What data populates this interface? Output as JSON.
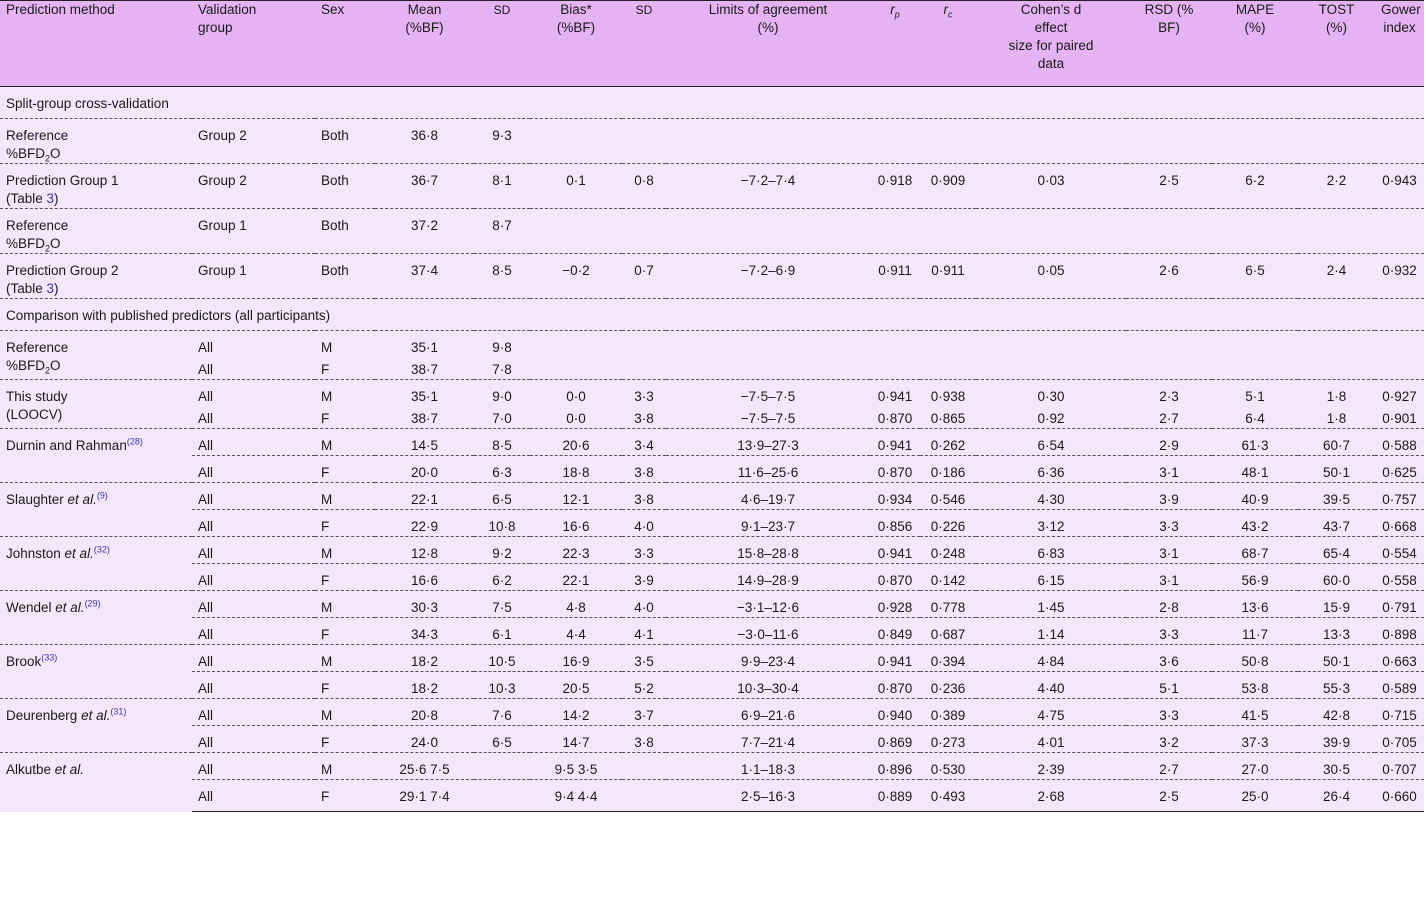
{
  "header": {
    "method": "Prediction method",
    "group": "Validation group",
    "sex": "Sex",
    "mean": "Mean (%BF)",
    "sd1": "SD",
    "bias": "Bias* (%BF)",
    "sd2": "SD",
    "loa": "Limits of agreement (%)",
    "rp": "rp",
    "rc": "rc",
    "cohen": "Cohen’s d effect size for paired data",
    "rsd": "RSD (% BF)",
    "mape": "MAPE (%)",
    "tost": "TOST (%)",
    "gower": "Gower index"
  },
  "sections": {
    "split": "Split-group cross-validation",
    "published": "Comparison with published predictors (all participants)"
  },
  "labels": {
    "reference": "Reference",
    "bfd2o_pre": "%BFD",
    "bfd2o_sub": "2",
    "bfd2o_post": "O",
    "pred_g1": "Prediction Group 1",
    "pred_g2": "Prediction Group 2",
    "table_open": "(Table ",
    "table_num": "3",
    "table_close": ")",
    "this_study": "This study",
    "loocv": "(LOOCV)",
    "etal": "et al.",
    "durnin": "Durnin and Rahman",
    "durnin_ref": "(28)",
    "slaughter": "Slaughter ",
    "slaughter_ref": "(9)",
    "johnston": "Johnston ",
    "johnston_ref": "(32)",
    "wendel": "Wendel ",
    "wendel_ref": "(29)",
    "brook": "Brook",
    "brook_ref": "(33)",
    "deurenberg": "Deurenberg ",
    "deurenberg_ref": "(31)",
    "alkutbe": "Alkutbe "
  },
  "rows": {
    "ref_g2": [
      "Group 2",
      "Both",
      "36·8",
      "9·3",
      "",
      "",
      "",
      "",
      "",
      "",
      "",
      "",
      "",
      ""
    ],
    "pred_g1": [
      "Group 2",
      "Both",
      "36·7",
      "8·1",
      "0·1",
      "0·8",
      "−7·2–7·4",
      "0·918",
      "0·909",
      "0·03",
      "2·5",
      "6·2",
      "2·2",
      "0·943"
    ],
    "ref_g1": [
      "Group 1",
      "Both",
      "37·2",
      "8·7",
      "",
      "",
      "",
      "",
      "",
      "",
      "",
      "",
      "",
      ""
    ],
    "pred_g2": [
      "Group 1",
      "Both",
      "37·4",
      "8·5",
      "−0·2",
      "0·7",
      "−7·2–6·9",
      "0·911",
      "0·911",
      "0·05",
      "2·6",
      "6·5",
      "2·4",
      "0·932"
    ],
    "ref_m": [
      "All",
      "M",
      "35·1",
      "9·8",
      "",
      "",
      "",
      "",
      "",
      "",
      "",
      "",
      "",
      ""
    ],
    "ref_f": [
      "All",
      "F",
      "38·7",
      "7·8",
      "",
      "",
      "",
      "",
      "",
      "",
      "",
      "",
      "",
      ""
    ],
    "study_m": [
      "All",
      "M",
      "35·1",
      "9·0",
      "0·0",
      "3·3",
      "−7·5–7·5",
      "0·941",
      "0·938",
      "0·30",
      "2·3",
      "5·1",
      "1·8",
      "0·927"
    ],
    "study_f": [
      "All",
      "F",
      "38·7",
      "7·0",
      "0·0",
      "3·8",
      "−7·5–7·5",
      "0·870",
      "0·865",
      "0·92",
      "2·7",
      "6·4",
      "1·8",
      "0·901"
    ],
    "durnin_m": [
      "All",
      "M",
      "14·5",
      "8·5",
      "20·6",
      "3·4",
      "13·9–27·3",
      "0·941",
      "0·262",
      "6·54",
      "2·9",
      "61·3",
      "60·7",
      "0·588"
    ],
    "durnin_f": [
      "All",
      "F",
      "20·0",
      "6·3",
      "18·8",
      "3·8",
      "11·6–25·6",
      "0·870",
      "0·186",
      "6·36",
      "3·1",
      "48·1",
      "50·1",
      "0·625"
    ],
    "slaughter_m": [
      "All",
      "M",
      "22·1",
      "6·5",
      "12·1",
      "3·8",
      "4·6–19·7",
      "0·934",
      "0·546",
      "4·30",
      "3·9",
      "40·9",
      "39·5",
      "0·757"
    ],
    "slaughter_f": [
      "All",
      "F",
      "22·9",
      "10·8",
      "16·6",
      "4·0",
      "9·1–23·7",
      "0·856",
      "0·226",
      "3·12",
      "3·3",
      "43·2",
      "43·7",
      "0·668"
    ],
    "johnston_m": [
      "All",
      "M",
      "12·8",
      "9·2",
      "22·3",
      "3·3",
      "15·8–28·8",
      "0·941",
      "0·248",
      "6·83",
      "3·1",
      "68·7",
      "65·4",
      "0·554"
    ],
    "johnston_f": [
      "All",
      "F",
      "16·6",
      "6·2",
      "22·1",
      "3·9",
      "14·9–28·9",
      "0·870",
      "0·142",
      "6·15",
      "3·1",
      "56·9",
      "60·0",
      "0·558"
    ],
    "wendel_m": [
      "All",
      "M",
      "30·3",
      "7·5",
      "4·8",
      "4·0",
      "−3·1–12·6",
      "0·928",
      "0·778",
      "1·45",
      "2·8",
      "13·6",
      "15·9",
      "0·791"
    ],
    "wendel_f": [
      "All",
      "F",
      "34·3",
      "6·1",
      "4·4",
      "4·1",
      "−3·0–11·6",
      "0·849",
      "0·687",
      "1·14",
      "3·3",
      "11·7",
      "13·3",
      "0·898"
    ],
    "brook_m": [
      "All",
      "M",
      "18·2",
      "10·5",
      "16·9",
      "3·5",
      "9·9–23·4",
      "0·941",
      "0·394",
      "4·84",
      "3·6",
      "50·8",
      "50·1",
      "0·663"
    ],
    "brook_f": [
      "All",
      "F",
      "18·2",
      "10·3",
      "20·5",
      "5·2",
      "10·3–30·4",
      "0·870",
      "0·236",
      "4·40",
      "5·1",
      "53·8",
      "55·3",
      "0·589"
    ],
    "deurenberg_m": [
      "All",
      "M",
      "20·8",
      "7·6",
      "14·2",
      "3·7",
      "6·9–21·6",
      "0·940",
      "0·389",
      "4·75",
      "3·3",
      "41·5",
      "42·8",
      "0·715"
    ],
    "deurenberg_f": [
      "All",
      "F",
      "24·0",
      "6·5",
      "14·7",
      "3·8",
      "7·7–21·4",
      "0·869",
      "0·273",
      "4·01",
      "3·2",
      "37·3",
      "39·9",
      "0·705"
    ],
    "alkutbe_m": [
      "All",
      "M",
      "25·6 7·5",
      "",
      "9·5 3·5",
      "",
      "1·1–18·3",
      "0·896",
      "0·530",
      "2·39",
      "2·7",
      "27·0",
      "30·5",
      "0·707"
    ],
    "alkutbe_f": [
      "All",
      "F",
      "29·1 7·4",
      "",
      "9·4 4·4",
      "",
      "2·5–16·3",
      "0·889",
      "0·493",
      "2·68",
      "2·5",
      "25·0",
      "26·4",
      "0·660"
    ]
  }
}
